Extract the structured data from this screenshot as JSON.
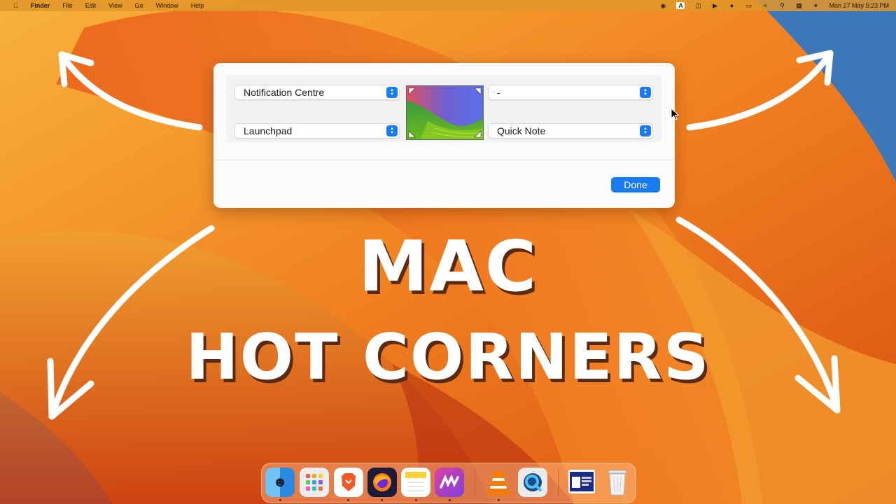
{
  "menubar": {
    "apple_icon": "apple-logo-icon",
    "items": [
      "Finder",
      "File",
      "Edit",
      "View",
      "Go",
      "Window",
      "Help"
    ],
    "input_badge": "A",
    "datetime": "Mon 27 May  5:23 PM"
  },
  "hot_corners": {
    "top_left": "Notification Centre",
    "top_right": "-",
    "bottom_left": "Launchpad",
    "bottom_right": "Quick Note",
    "done_label": "Done"
  },
  "overlay": {
    "line1": "MAC",
    "line2": "HOT CORNERS"
  },
  "dock": {
    "apps": [
      "finder-icon",
      "launchpad-icon",
      "brave-icon",
      "firefox-icon",
      "notes-icon",
      "onenote-icon",
      "vlc-icon",
      "quicktime-icon",
      "screenshot-icon",
      "trash-icon"
    ]
  },
  "colors": {
    "accent": "#1a7af0",
    "wallpaper": "#ee8a1e",
    "arrow": "#ffffff"
  }
}
